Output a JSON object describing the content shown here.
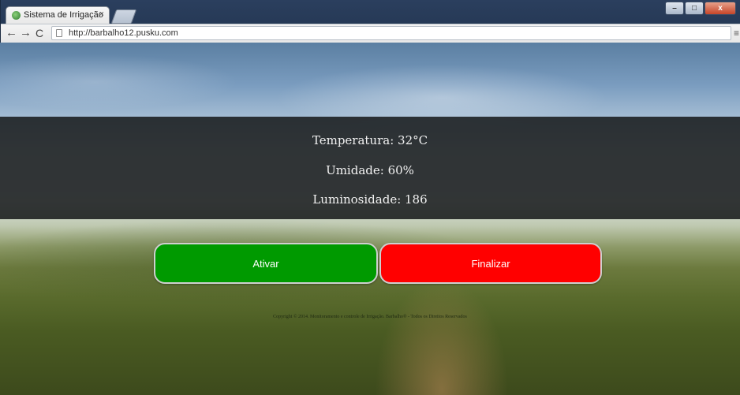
{
  "browser": {
    "tab_title": "Sistema de Irrigação",
    "tab_close": "×",
    "url": "http://barbalho12.pusku.com",
    "back_glyph": "←",
    "forward_glyph": "→",
    "reload_glyph": "C",
    "menu_glyph": "≡",
    "window_buttons": {
      "minimize": "–",
      "maximize": "□",
      "close": "x"
    }
  },
  "readings": {
    "temperature": "Temperatura: 32°C",
    "humidity": "Umidade: 60%",
    "luminosity": "Luminosidade: 186"
  },
  "actions": {
    "activate_label": "Ativar",
    "finish_label": "Finalizar"
  },
  "footer": {
    "copyright": "Copyright © 2014. Monitoramento e controle de Irrigação. Barbalho® - Todos os Direitos Reservados"
  },
  "colors": {
    "activate": "#009a00",
    "finish": "#ff0000"
  }
}
